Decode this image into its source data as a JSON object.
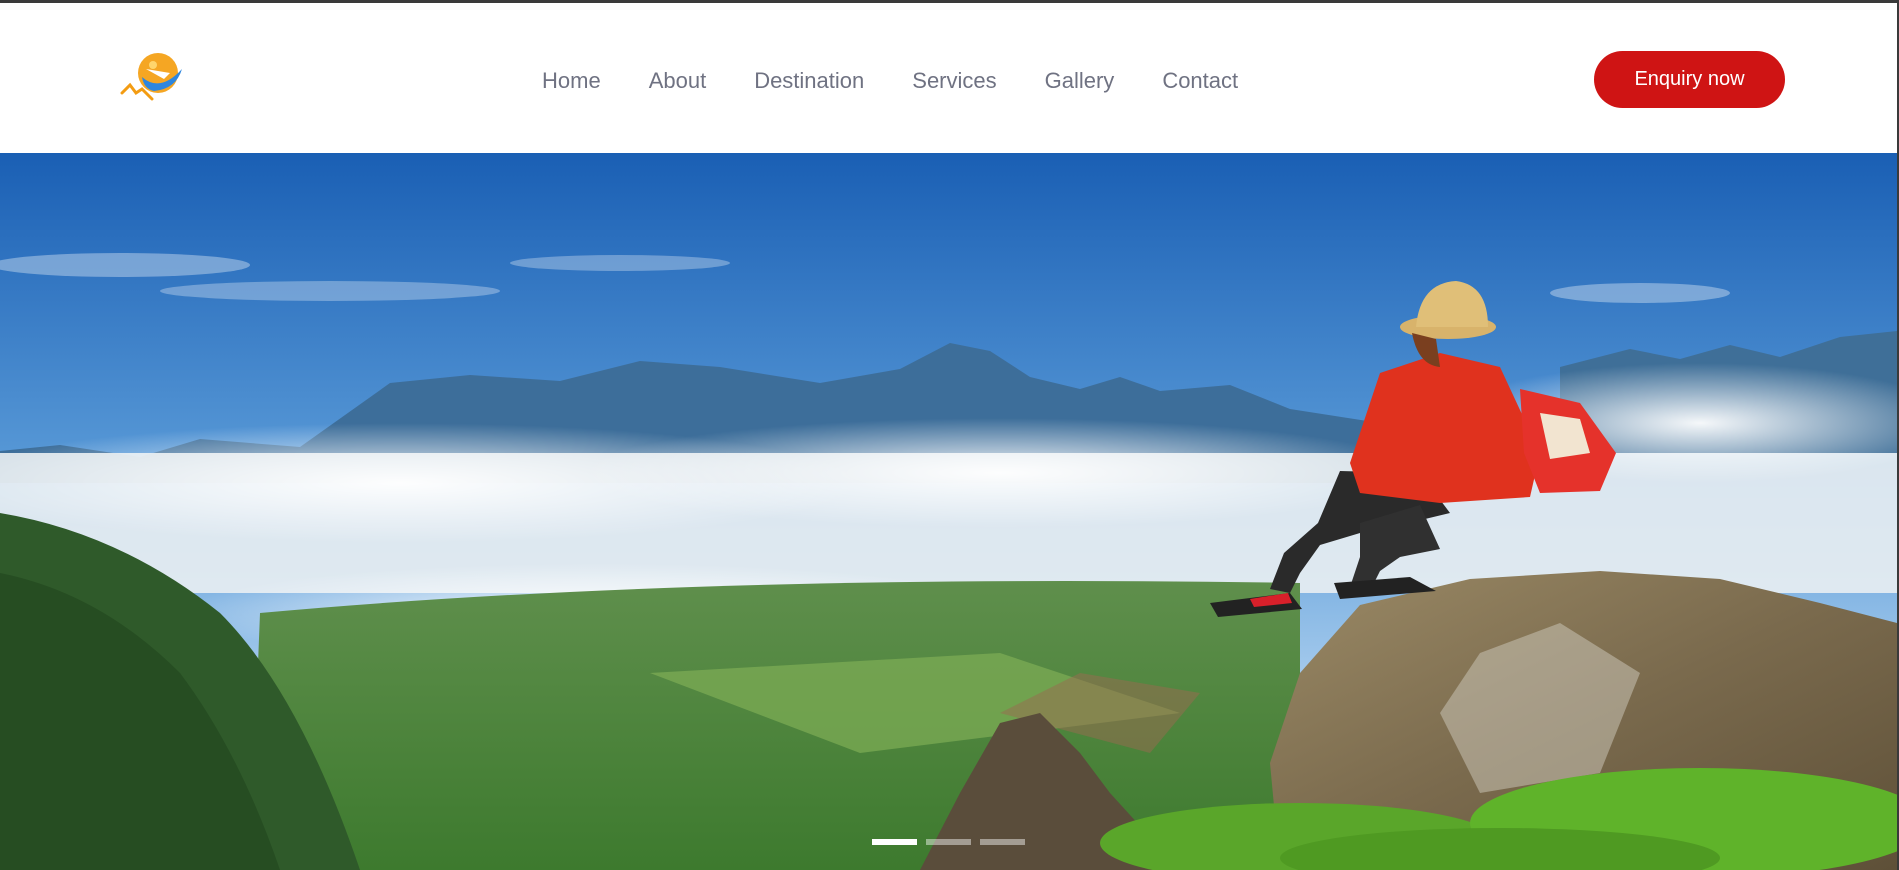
{
  "nav": {
    "logo_icon": "travel-globe-plane-logo-icon",
    "links": [
      {
        "label": "Home"
      },
      {
        "label": "About"
      },
      {
        "label": "Destination"
      },
      {
        "label": "Services"
      },
      {
        "label": "Gallery"
      },
      {
        "label": "Contact"
      }
    ],
    "cta_label": "Enquiry now"
  },
  "colors": {
    "accent": "#cf1414",
    "nav_text": "#6f7282",
    "logo_orange": "#f39c12",
    "logo_blue": "#2e86de"
  },
  "hero": {
    "image": "hiker-with-red-jacket-sitting-on-rock-above-cloudy-valley",
    "slides": {
      "count": 3,
      "active_index": 0
    }
  }
}
